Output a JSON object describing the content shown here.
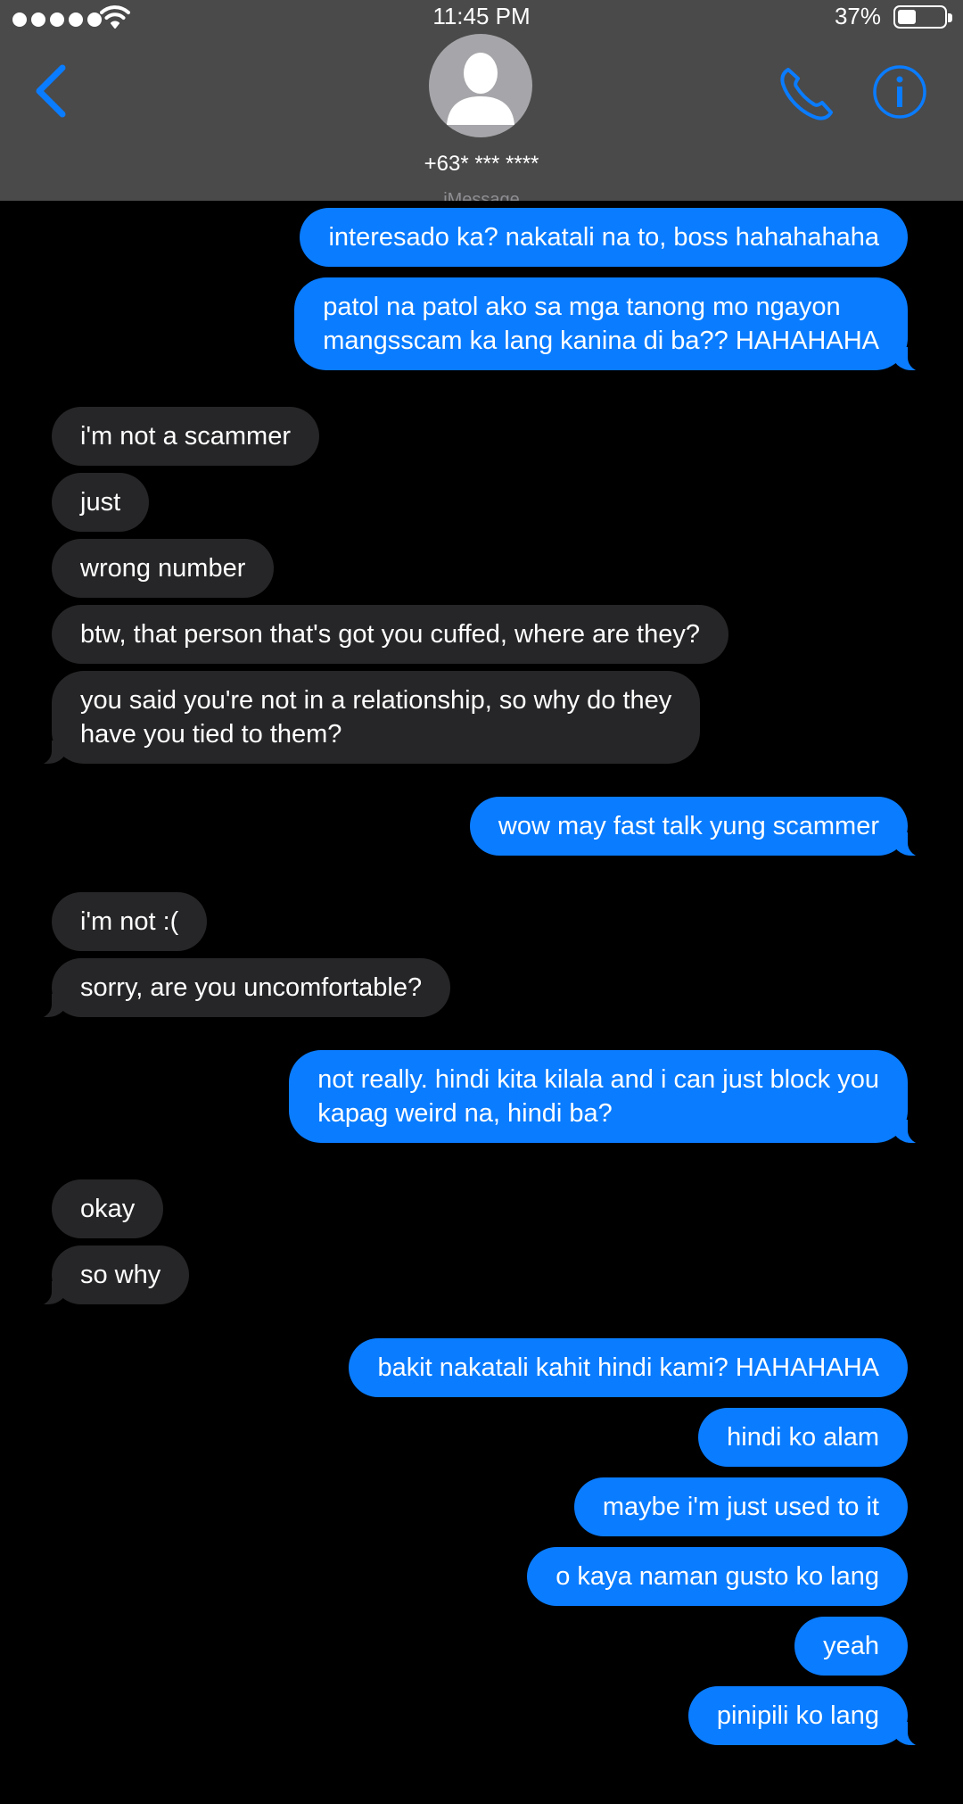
{
  "status_bar": {
    "time": "11:45 PM",
    "battery": "37%"
  },
  "header": {
    "contact": "+63* *** ****",
    "hidden_label": "iMessage"
  },
  "messages": [
    {
      "from": "me",
      "text": "interesado ka? nakatali na to, boss hahahahaha"
    },
    {
      "from": "me",
      "lines": [
        "patol na patol ako sa mga tanong mo ngayon",
        "mangsscam ka lang kanina di ba?? HAHAHAHA"
      ]
    },
    {
      "from": "them",
      "text": "i'm not a scammer"
    },
    {
      "from": "them",
      "text": "just"
    },
    {
      "from": "them",
      "text": "wrong number"
    },
    {
      "from": "them",
      "text": "btw, that person that's got you cuffed, where are they?"
    },
    {
      "from": "them",
      "lines": [
        "you said you're not in a relationship, so why do they",
        "have you tied to them?"
      ]
    },
    {
      "from": "me",
      "text": "wow may fast talk yung scammer"
    },
    {
      "from": "them",
      "text": "i'm not :("
    },
    {
      "from": "them",
      "text": "sorry, are you uncomfortable?"
    },
    {
      "from": "me",
      "lines": [
        "not really. hindi kita kilala and i can just block you",
        "kapag weird na, hindi ba?"
      ]
    },
    {
      "from": "them",
      "text": "okay"
    },
    {
      "from": "them",
      "text": "so why"
    },
    {
      "from": "me",
      "text": "bakit nakatali kahit hindi kami? HAHAHAHA"
    },
    {
      "from": "me",
      "text": "hindi ko alam"
    },
    {
      "from": "me",
      "text": "maybe i'm just used to it"
    },
    {
      "from": "me",
      "text": "o kaya naman gusto ko lang"
    },
    {
      "from": "me",
      "text": "yeah"
    },
    {
      "from": "me",
      "text": "pinipili ko lang"
    }
  ]
}
